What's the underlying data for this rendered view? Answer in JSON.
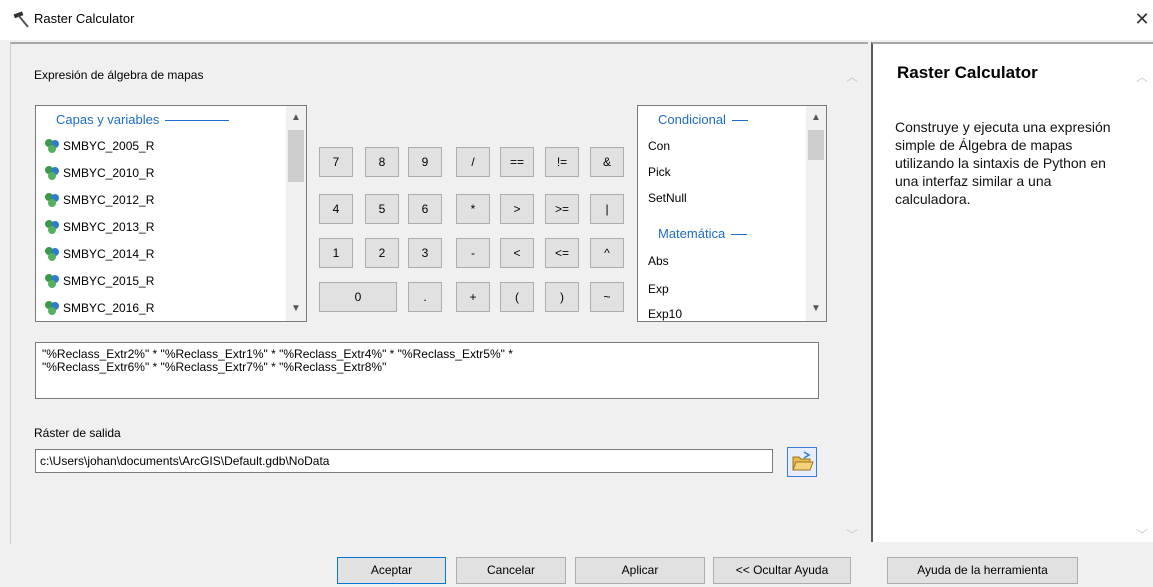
{
  "window": {
    "title": "Raster Calculator",
    "close_glyph": "✕"
  },
  "expression": {
    "label": "Expresión de álgebra de mapas",
    "text_line1": "\"%Reclass_Extr2%\" * \"%Reclass_Extr1%\" * \"%Reclass_Extr4%\" * \"%Reclass_Extr5%\" *",
    "text_line2": "\"%Reclass_Extr6%\" * \"%Reclass_Extr7%\" * \"%Reclass_Extr8%\""
  },
  "layers": {
    "header": "Capas y variables",
    "items": [
      "SMBYC_2005_R",
      "SMBYC_2010_R",
      "SMBYC_2012_R",
      "SMBYC_2013_R",
      "SMBYC_2014_R",
      "SMBYC_2015_R",
      "SMBYC_2016_R"
    ]
  },
  "functions": {
    "header_conditional": "Condicional",
    "conditional_items": [
      "Con",
      "Pick",
      "SetNull"
    ],
    "header_math": "Matemática",
    "math_items": [
      "Abs",
      "Exp",
      "Exp10"
    ]
  },
  "calculator": {
    "row1": [
      "7",
      "8",
      "9",
      "/",
      "==",
      "!=",
      "&"
    ],
    "row2": [
      "4",
      "5",
      "6",
      "*",
      ">",
      ">=",
      "|"
    ],
    "row3": [
      "1",
      "2",
      "3",
      "-",
      "<",
      "<=",
      "^"
    ],
    "row4": [
      "0",
      ".",
      "+",
      "(",
      ")",
      "~"
    ]
  },
  "output": {
    "label": "Ráster de salida",
    "value": "c:\\Users\\johan\\documents\\ArcGIS\\Default.gdb\\NoData"
  },
  "help": {
    "title": "Raster Calculator",
    "text": "Construye y ejecuta una expresión simple de Álgebra de mapas utilizando la sintaxis de Python en una interfaz similar a una calculadora."
  },
  "footer": {
    "accept": "Aceptar",
    "cancel": "Cancelar",
    "apply": "Aplicar",
    "hide_help": "<< Ocultar Ayuda",
    "tool_help": "Ayuda de la herramienta"
  },
  "colors": {
    "accent_blue": "#1e6cc7",
    "focus_border": "#0078d7"
  }
}
